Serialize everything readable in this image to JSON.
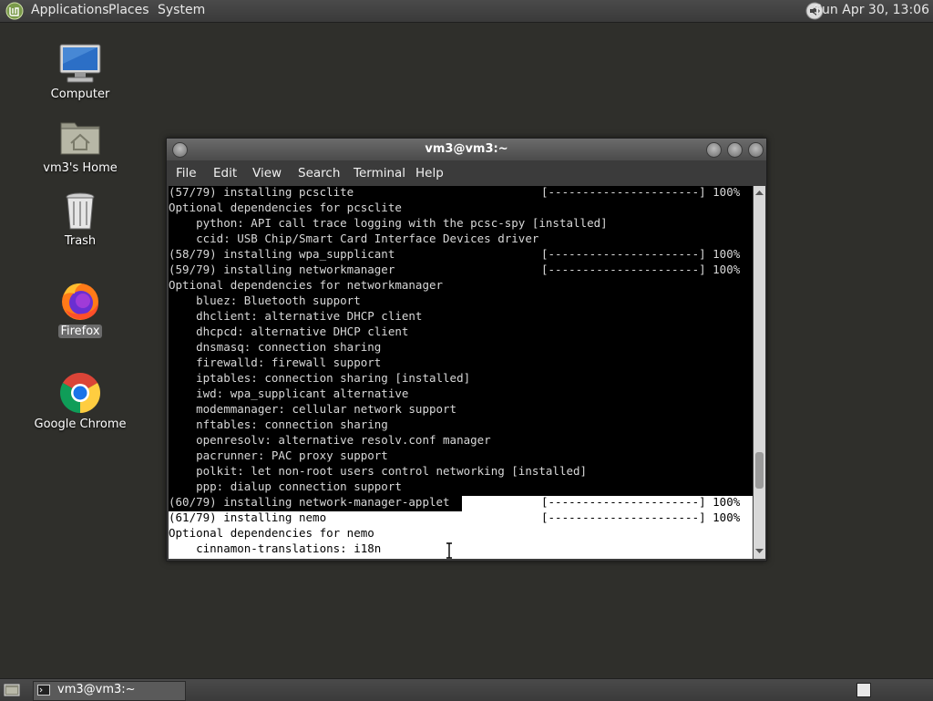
{
  "top_panel": {
    "menus": [
      "Applications",
      "Places",
      "System"
    ],
    "clock": "Sun Apr 30, 13:06",
    "icons": [
      "mint-menu-icon",
      "volume-icon"
    ]
  },
  "desktop": {
    "icons": [
      {
        "label": "Computer",
        "icon": "computer-icon"
      },
      {
        "label": "vm3's Home",
        "icon": "home-folder-icon"
      },
      {
        "label": "Trash",
        "icon": "trash-icon"
      },
      {
        "label": "Firefox",
        "icon": "firefox-icon",
        "selected": true
      },
      {
        "label": "Google Chrome",
        "icon": "chrome-icon"
      }
    ]
  },
  "terminal": {
    "title": "vm3@vm3:~",
    "menu": [
      "File",
      "Edit",
      "View",
      "Search",
      "Terminal",
      "Help"
    ],
    "lines": [
      {
        "text": "(57/79) installing pcsclite",
        "bar": "[----------------------] 100%"
      },
      {
        "text": "Optional dependencies for pcsclite"
      },
      {
        "text": "    python: API call trace logging with the pcsc-spy [installed]"
      },
      {
        "text": "    ccid: USB Chip/Smart Card Interface Devices driver"
      },
      {
        "text": "(58/79) installing wpa_supplicant",
        "bar": "[----------------------] 100%"
      },
      {
        "text": "(59/79) installing networkmanager",
        "bar": "[----------------------] 100%"
      },
      {
        "text": "Optional dependencies for networkmanager"
      },
      {
        "text": "    bluez: Bluetooth support"
      },
      {
        "text": "    dhclient: alternative DHCP client"
      },
      {
        "text": "    dhcpcd: alternative DHCP client"
      },
      {
        "text": "    dnsmasq: connection sharing"
      },
      {
        "text": "    firewalld: firewall support"
      },
      {
        "text": "    iptables: connection sharing [installed]"
      },
      {
        "text": "    iwd: wpa_supplicant alternative"
      },
      {
        "text": "    modemmanager: cellular network support"
      },
      {
        "text": "    nftables: connection sharing"
      },
      {
        "text": "    openresolv: alternative resolv.conf manager"
      },
      {
        "text": "    pacrunner: PAC proxy support"
      },
      {
        "text": "    polkit: let non-root users control networking [installed]"
      },
      {
        "text": "    ppp: dialup connection support"
      },
      {
        "text": "(60/79) installing network-manager-applet",
        "bar": "[----------------------] 100%"
      },
      {
        "text": "(61/79) installing nemo",
        "bar": "[----------------------] 100%"
      },
      {
        "text": "Optional dependencies for nemo"
      },
      {
        "text": "    cinnamon-translations: i18n"
      }
    ],
    "scroll_position": 0.78
  },
  "bottom_panel": {
    "task_label": "vm3@vm3:~",
    "icons": [
      "show-desktop-icon",
      "terminal-icon",
      "workspace-switcher-icon"
    ]
  }
}
